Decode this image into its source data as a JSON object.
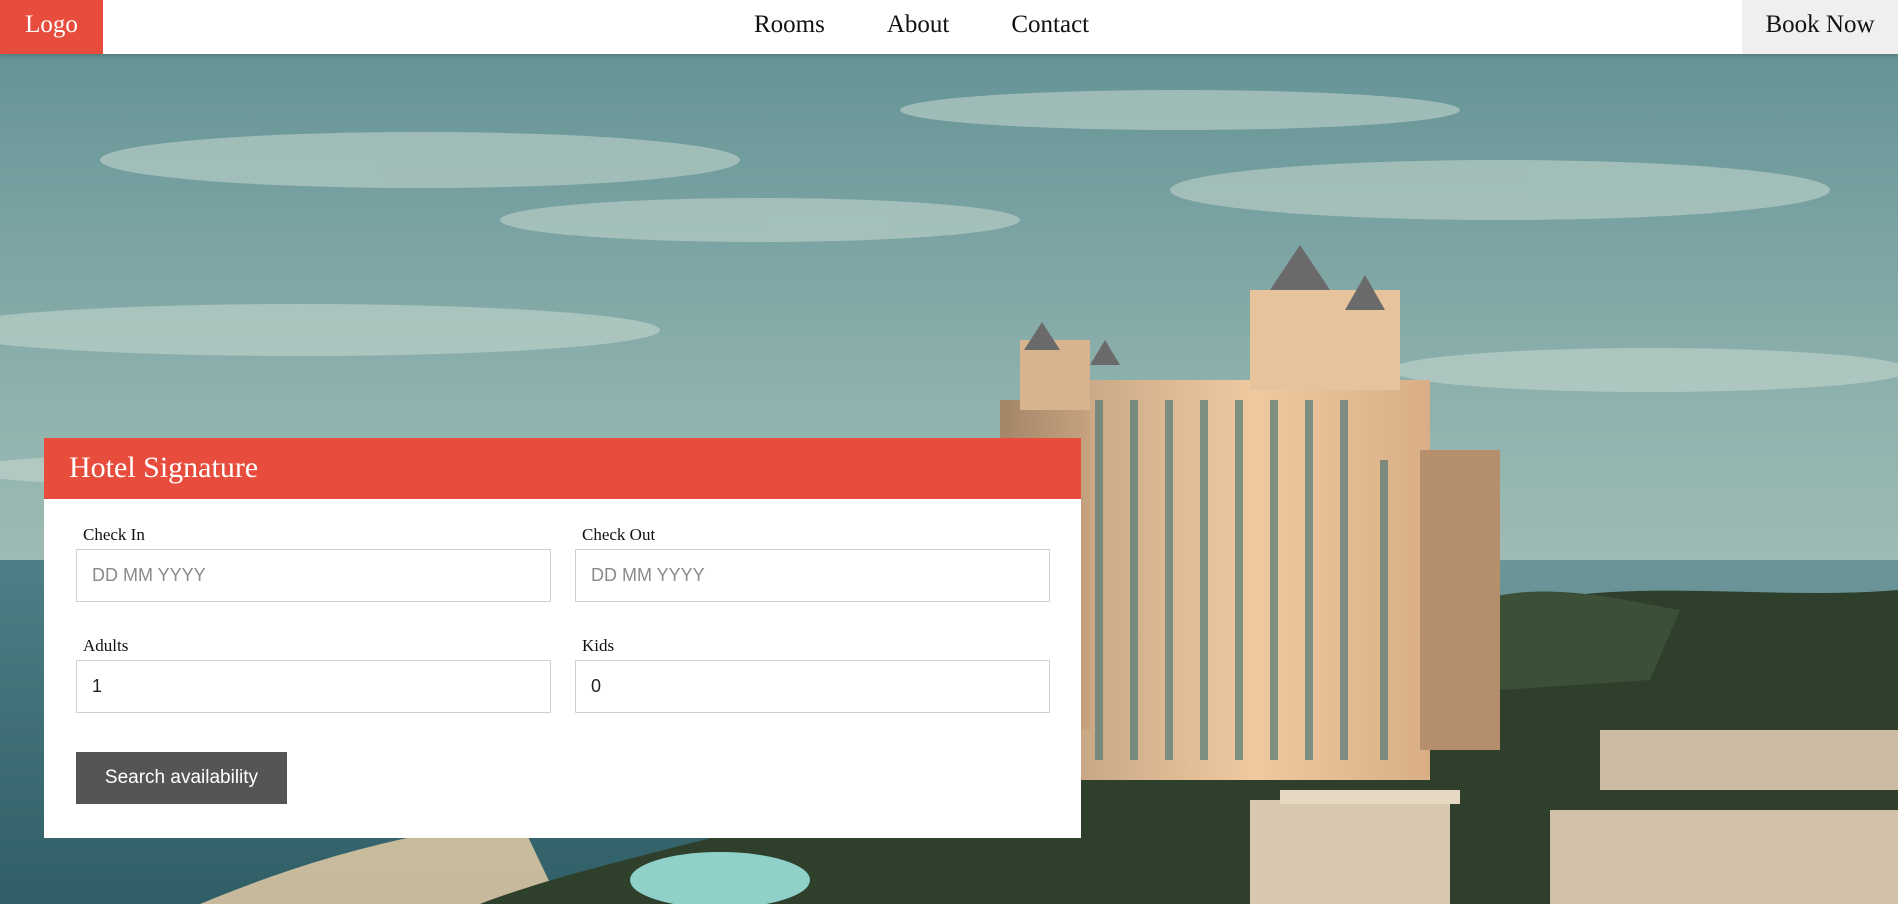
{
  "colors": {
    "brand_red": "#e74c3c",
    "button_dark": "#555555"
  },
  "header": {
    "logo_label": "Logo",
    "nav": [
      {
        "label": "Rooms"
      },
      {
        "label": "About"
      },
      {
        "label": "Contact"
      }
    ],
    "book_label": "Book Now"
  },
  "booking": {
    "title": "Hotel Signature",
    "check_in": {
      "label": "Check In",
      "placeholder": "DD MM YYYY",
      "value": ""
    },
    "check_out": {
      "label": "Check Out",
      "placeholder": "DD MM YYYY",
      "value": ""
    },
    "adults": {
      "label": "Adults",
      "value": "1"
    },
    "kids": {
      "label": "Kids",
      "value": "0"
    },
    "search_label": "Search availability"
  }
}
